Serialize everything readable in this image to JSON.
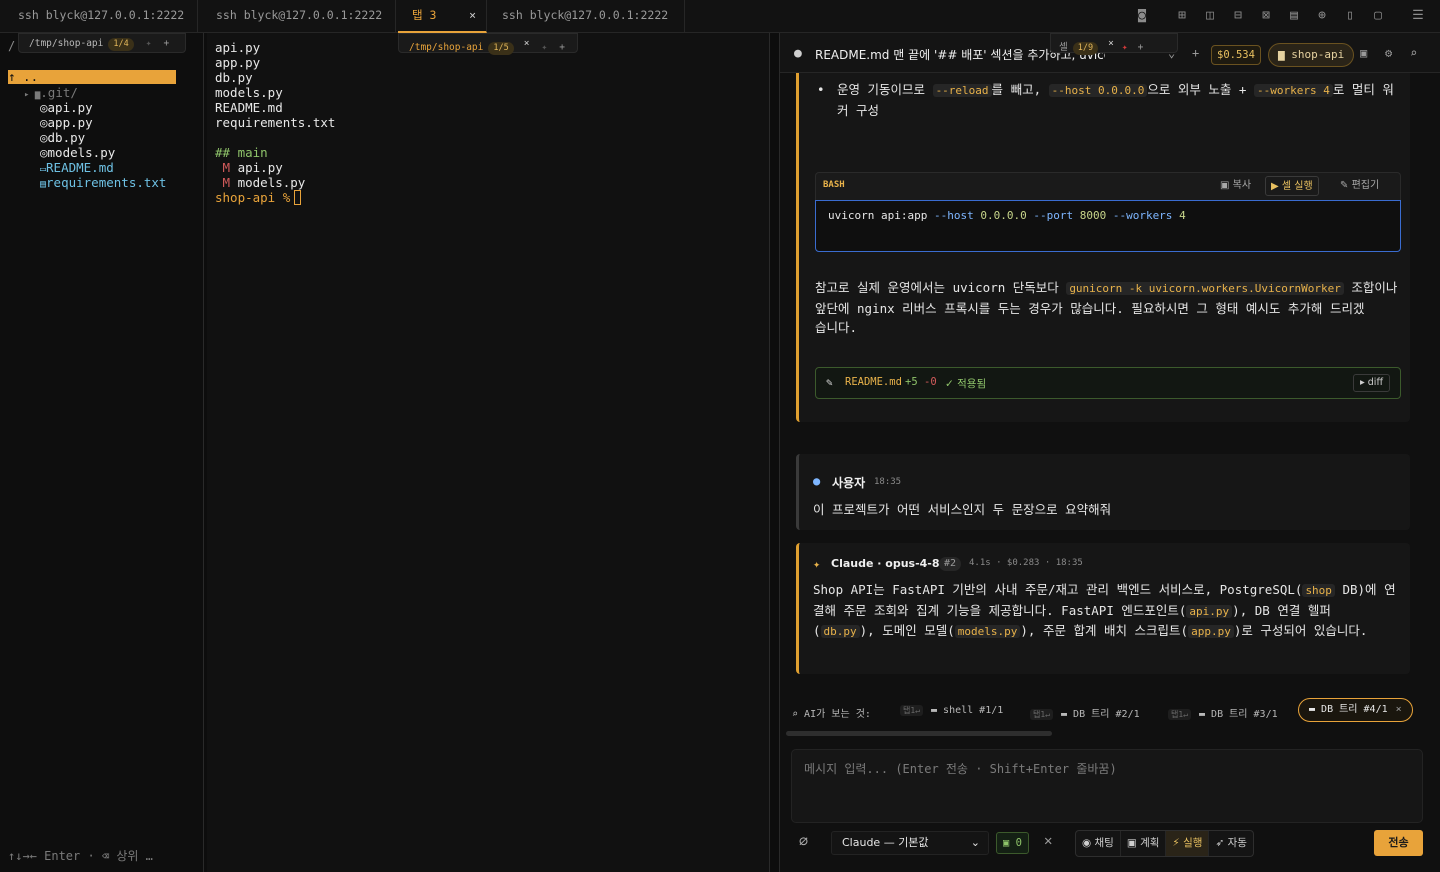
{
  "tabs": [
    {
      "label": "ssh blyck@127.0.0.1:2222"
    },
    {
      "label": "ssh blyck@127.0.0.1:2222"
    },
    {
      "label": "탭 3",
      "close": "×"
    },
    {
      "label": "ssh blyck@127.0.0.1:2222"
    }
  ],
  "toolbar_icons": [
    "camera-icon",
    "plus-square-icon",
    "split-vertical-icon",
    "split-horizontal-icon",
    "close-square-icon",
    "terminal-icon",
    "globe-icon",
    "bookmark-icon",
    "window-icon",
    "menu-icon"
  ],
  "left_pane": {
    "slash": "/",
    "path": "/tmp/shop-api",
    "badge": "1/4",
    "pin": "📌",
    "plus": "+",
    "up_row": "↑     ..",
    "items": [
      {
        "icon": "▸ ▆",
        "name": ".git/",
        "kind": "dir"
      },
      {
        "icon": "◎",
        "name": "api.py",
        "kind": "py"
      },
      {
        "icon": "◎",
        "name": "app.py",
        "kind": "py"
      },
      {
        "icon": "◎",
        "name": "db.py",
        "kind": "py"
      },
      {
        "icon": "◎",
        "name": "models.py",
        "kind": "py"
      },
      {
        "icon": "▭",
        "name": "README.md",
        "kind": "md"
      },
      {
        "icon": "▤",
        "name": "requirements.txt",
        "kind": "txt"
      }
    ],
    "hint": "↑↓→← Enter · ⌫ 상위 …"
  },
  "mid_pane": {
    "path": "/tmp/shop-api",
    "badge": "1/5",
    "close": "×",
    "plus": "+",
    "lines": [
      "api.py",
      "app.py",
      "db.py",
      "models.py",
      "README.md",
      "requirements.txt"
    ],
    "git_header": "## main",
    "modified": [
      {
        "flag": "M",
        "file": "api.py"
      },
      {
        "flag": "M",
        "file": "models.py"
      }
    ],
    "prompt": "shop-api %"
  },
  "chat": {
    "title": "README.md 맨 끝에 '## 배포' 섹션을 추가하고, uvicorn",
    "cell_label": "셀",
    "cell_badge": "1/9",
    "cell_close": "×",
    "cost": "$0.534",
    "project": "shop-api",
    "bullet": {
      "t1": "운영 기동이므로 ",
      "c1": "--reload",
      "t2": "를 빼고, ",
      "c2": "--host 0.0.0.0",
      "t3": "으로 외부 노출 + ",
      "c3": "--workers 4",
      "t4": "로 멀티 워",
      "t5": "커 구성"
    },
    "code": {
      "lang": "BASH",
      "copy": "복사",
      "run": "셀 실행",
      "edit": "편집기",
      "cmd": "uvicorn api:app",
      "f1": "--host",
      "v1": "0.0.0.0",
      "f2": "--port",
      "v2": "8000",
      "f3": "--workers",
      "v3": "4"
    },
    "note": {
      "t1": "참고로 실제 운영에서는 uvicorn 단독보다 ",
      "c1": "gunicorn -k uvicorn.workers.UvicornWorker",
      "t2": " 조합이나",
      "l2": "앞단에 nginx 리버스 프록시를 두는 경우가 많습니다. 필요하시면 그 형태 예시도 추가해 드리겠",
      "l3": "습니다."
    },
    "diff": {
      "file": "README.md",
      "add": "+5",
      "del": "-0",
      "status": "✓ 적용됨",
      "btn": "▸ diff"
    },
    "user": {
      "name": "사용자",
      "time": "18:35",
      "text": "이 프로젝트가 어떤 서비스인지 두 문장으로 요약해줘"
    },
    "assistant": {
      "name": "Claude · opus-4-8",
      "tag": "#2",
      "meta": "4.1s · $0.283 · 18:35",
      "l1a": "Shop API는 FastAPI 기반의 사내 주문/재고 관리 백엔드 서비스로, PostgreSQL(",
      "c1": "shop",
      "l1b": " DB)에 연",
      "l2a": "결해 주문 조회와 집계 기능을 제공합니다. FastAPI 엔드포인트(",
      "c2": "api.py",
      "l2b": "), DB 연결 헬퍼",
      "l3a": "(",
      "c3": "db.py",
      "l3b": "), 도메인 모델(",
      "c4": "models.py",
      "l3c": "), 주문 합계 배치 스크립트(",
      "c5": "app.py",
      "l3d": ")로 구성되어 있습니다."
    },
    "context": {
      "label": "AI가 보는 것:",
      "kbd": "탭1↵",
      "items": [
        "shell #1/1",
        "DB 트리 #2/1",
        "DB 트리 #3/1"
      ],
      "active": "DB 트리 #4/1",
      "active_close": "×"
    },
    "input_placeholder": "메시지 입력... (Enter 전송 · Shift+Enter 줄바꿈)",
    "model": "Claude — 기본값",
    "counter": "0",
    "modes": [
      {
        "label": "채팅",
        "icon": "💬"
      },
      {
        "label": "계획",
        "icon": "📋"
      },
      {
        "label": "실행",
        "icon": "⚡",
        "active": true
      },
      {
        "label": "자동",
        "icon": "🚀"
      }
    ],
    "send": "전송"
  }
}
